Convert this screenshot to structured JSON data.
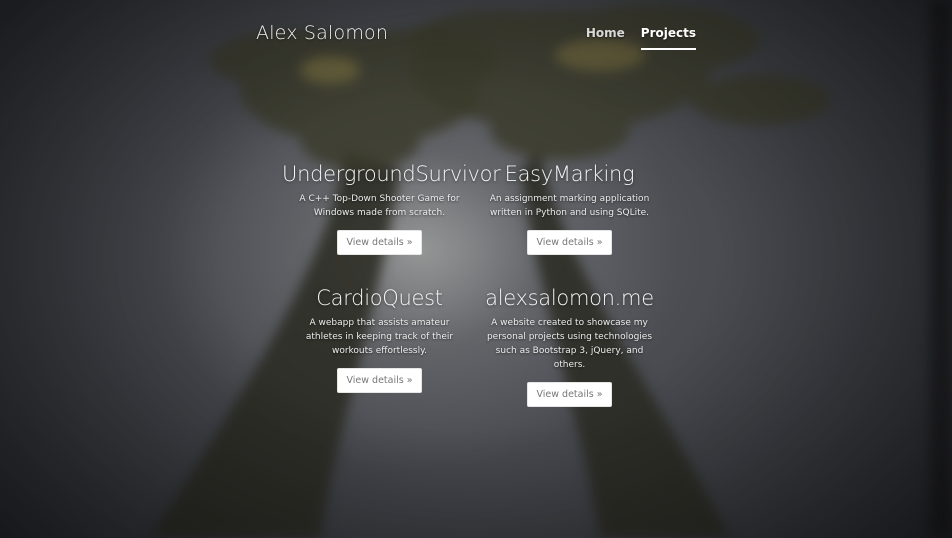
{
  "navbar": {
    "brand": "Alex Salomon",
    "links": [
      {
        "label": "Home",
        "active": false
      },
      {
        "label": "Projects",
        "active": true
      }
    ]
  },
  "projects": [
    {
      "title": "UndergroundSurvivor",
      "description": "A C++ Top-Down Shooter Game for Windows made from scratch.",
      "button": "View details »"
    },
    {
      "title": "EasyMarking",
      "description": "An assignment marking application written in Python and using SQLite.",
      "button": "View details »"
    },
    {
      "title": "CardioQuest",
      "description": "A webapp that assists amateur athletes in keeping track of their workouts effortlessly.",
      "button": "View details »"
    },
    {
      "title": "alexsalomon.me",
      "description": "A website created to showcase my personal projects using technologies such as Bootstrap 3, jQuery, and others.",
      "button": "View details »"
    }
  ],
  "colors": {
    "nav_active_underline": "#ffffff",
    "button_bg": "#ffffff",
    "button_text": "#777777"
  }
}
